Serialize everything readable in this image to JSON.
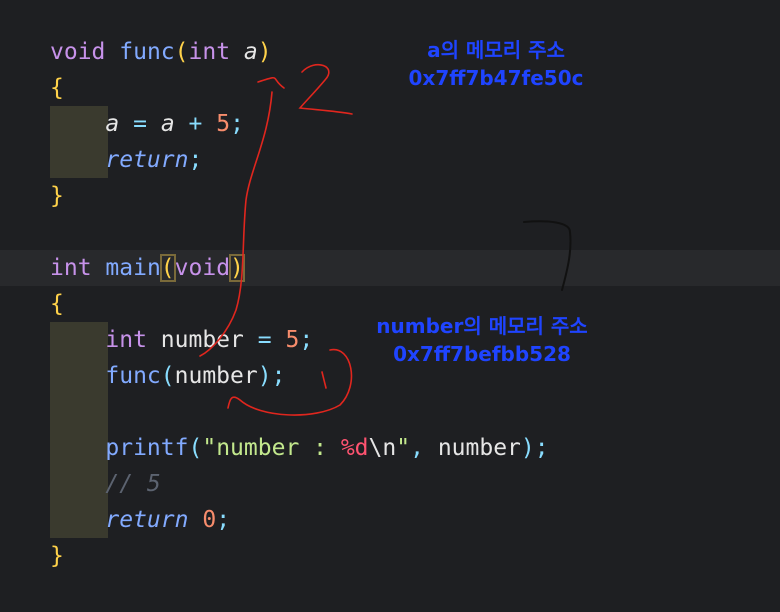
{
  "colors": {
    "background": "#1e1f22",
    "annotation_text": "#1f44ff",
    "ink_red": "#e0261e",
    "ink_black": "#111111"
  },
  "code": {
    "l1": {
      "kw": "void",
      "fn": "func",
      "open": "(",
      "type": "int",
      "param": "a",
      "close": ")"
    },
    "l2": {
      "brace": "{"
    },
    "l3": {
      "lhs": "a",
      "eq": "=",
      "rhs": "a",
      "plus": "+",
      "num": "5",
      "semi": ";"
    },
    "l4": {
      "ret": "return",
      "semi": ";"
    },
    "l5": {
      "brace": "}"
    },
    "l7": {
      "kw": "int",
      "fn": "main",
      "open": "(",
      "arg": "void",
      "close": ")"
    },
    "l8": {
      "brace": "{"
    },
    "l9": {
      "type": "int",
      "name": "number",
      "eq": "=",
      "num": "5",
      "semi": ";"
    },
    "l10": {
      "fn": "func",
      "open": "(",
      "arg": "number",
      "close": ")",
      "semi": ";"
    },
    "l12": {
      "fn": "printf",
      "open": "(",
      "q1": "\"",
      "str1": "number : ",
      "fmt": "%d",
      "esc": "\\n",
      "q2": "\"",
      "comma": ",",
      "arg": "number",
      "close": ")",
      "semi": ";"
    },
    "l13": {
      "comment": "// 5"
    },
    "l14": {
      "ret": "return",
      "num": "0",
      "semi": ";"
    },
    "l15": {
      "brace": "}"
    }
  },
  "annotations": {
    "a_label": "a의 메모리 주소",
    "a_address": "0x7ff7b47fe50c",
    "number_label": "number의 메모리 주소",
    "number_address": "0x7ff7befbb528"
  }
}
